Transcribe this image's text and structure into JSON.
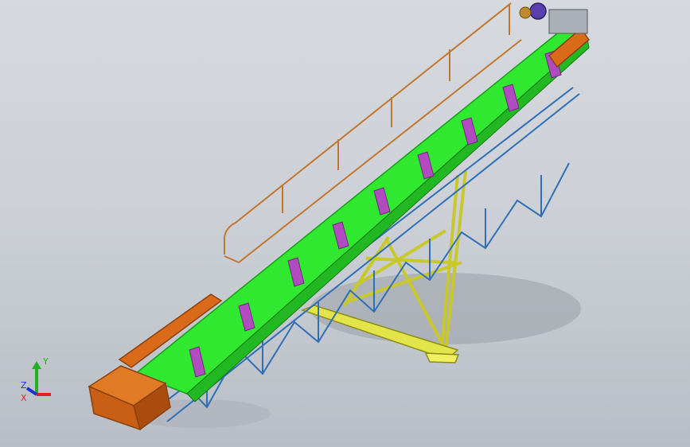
{
  "viewport": {
    "background_color": "#cfd3d9",
    "colors": {
      "belt": "#2fe82f",
      "belt_edge": "#1a9c1a",
      "frame": "#2f6fb5",
      "frame_dark": "#1f4f88",
      "support": "#d9d93a",
      "support_dark": "#9c9c1e",
      "hopper": "#d86a1a",
      "hopper_dark": "#8a4010",
      "railing": "#c07830",
      "bracket": "#b04cc0",
      "motor": "#5a3fb0"
    }
  },
  "triad": {
    "labels": {
      "x": "X",
      "y": "Y",
      "z": "Z"
    },
    "colors": {
      "x": "#e02020",
      "y": "#20b020",
      "z": "#2030d0"
    }
  }
}
